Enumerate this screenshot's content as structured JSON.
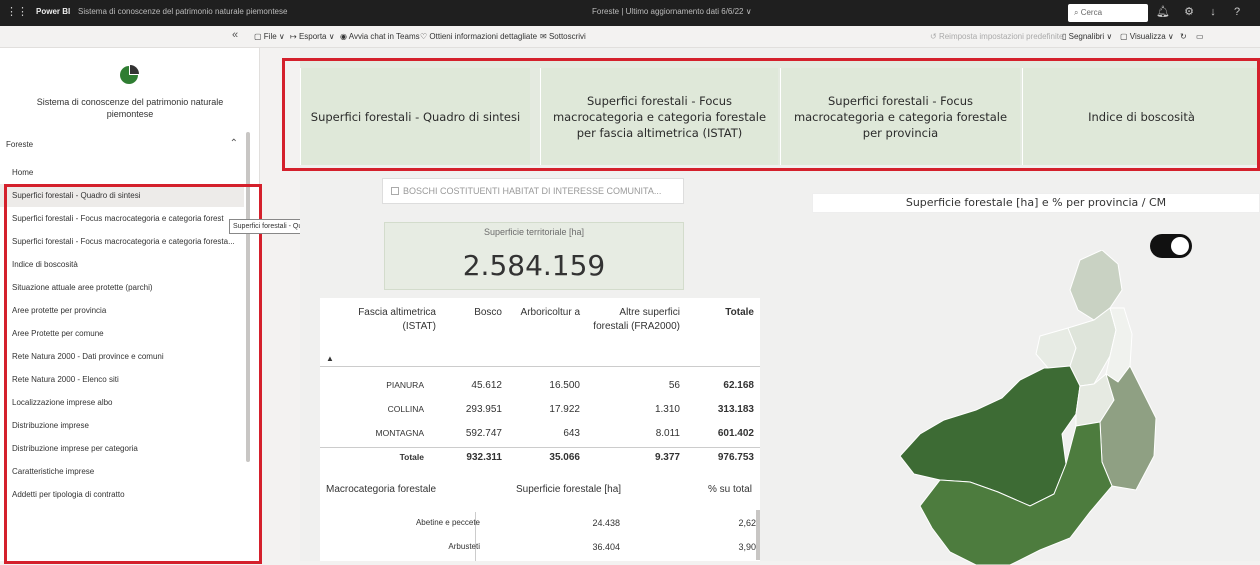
{
  "titlebar": {
    "product": "Power BI",
    "report_title": "Sistema di conoscenze del patrimonio naturale piemontese",
    "center_text": "Foreste  |  Ultimo aggiornamento dati 6/6/22  ∨",
    "search_placeholder": "Cerca",
    "icons": [
      "waffle-icon",
      "bell-icon",
      "gear-icon",
      "download-icon",
      "help-icon"
    ]
  },
  "toolbar": {
    "file": "File ∨",
    "export": "Esporta ∨",
    "teams": "Avvia chat in Teams",
    "insights": "Ottieni informazioni dettagliate",
    "subscribe": "Sottoscrivi",
    "reset": "Reimposta impostazioni predefinite",
    "bookmarks": "Segnalibri ∨",
    "view": "Visualizza ∨"
  },
  "sidebar": {
    "system_title": "Sistema di conoscenze del patrimonio naturale piemontese",
    "section": "Foreste",
    "items": [
      {
        "label": "Home",
        "active": false
      },
      {
        "label": "Superfici forestali - Quadro di sintesi",
        "active": true
      },
      {
        "label": "Superfici forestali - Focus macrocategoria e categoria forest",
        "active": false
      },
      {
        "label": "Superfici forestali - Focus macrocategoria e categoria foresta...",
        "active": false
      },
      {
        "label": "Indice di boscosità",
        "active": false
      },
      {
        "label": "Situazione attuale aree protette (parchi)",
        "active": false
      },
      {
        "label": "Aree protette per provincia",
        "active": false
      },
      {
        "label": "Aree Protette per comune",
        "active": false
      },
      {
        "label": "Rete Natura 2000 - Dati province e comuni",
        "active": false
      },
      {
        "label": "Rete Natura 2000 - Elenco siti",
        "active": false
      },
      {
        "label": "Localizzazione imprese albo",
        "active": false
      },
      {
        "label": "Distribuzione imprese",
        "active": false
      },
      {
        "label": "Distribuzione imprese per categoria",
        "active": false
      },
      {
        "label": "Caratteristiche imprese",
        "active": false
      },
      {
        "label": "Addetti per tipologia di contratto",
        "active": false
      }
    ],
    "tooltip": "Superfici forestali - Quadro di sintesi"
  },
  "tabs": [
    "Superfici forestali - Quadro di sintesi",
    "Superfici forestali - Focus macrocategoria e categoria forestale per fascia altimetrica (ISTAT)",
    "Superfici forestali - Focus macrocategoria e categoria forestale per provincia",
    "Indice di boscosità"
  ],
  "bookmark_button": "BOSCHI COSTITUENTI HABITAT DI INTERESSE COMUNITA...",
  "kpi": {
    "label": "Superficie territoriale [ha]",
    "value": "2.584.159"
  },
  "table1": {
    "headers": [
      "Fascia altimetrica (ISTAT)",
      "Bosco",
      "Arboricoltur a",
      "Altre superfici forestali (FRA2000)",
      "Totale"
    ],
    "rows": [
      [
        "PIANURA",
        "45.612",
        "16.500",
        "56",
        "62.168"
      ],
      [
        "COLLINA",
        "293.951",
        "17.922",
        "1.310",
        "313.183"
      ],
      [
        "MONTAGNA",
        "592.747",
        "643",
        "8.011",
        "601.402"
      ],
      [
        "Totale",
        "932.311",
        "35.066",
        "9.377",
        "976.753"
      ]
    ]
  },
  "table2": {
    "headers": [
      "Macrocategoria forestale",
      "Superficie forestale [ha]",
      "% su total"
    ],
    "rows": [
      [
        "Abetine e peccete",
        "24.438",
        "2,62"
      ],
      [
        "Arbusteti",
        "36.404",
        "3,90"
      ]
    ]
  },
  "map": {
    "title": "Superficie forestale [ha] e % per provincia / CM",
    "toggle_on": true
  }
}
